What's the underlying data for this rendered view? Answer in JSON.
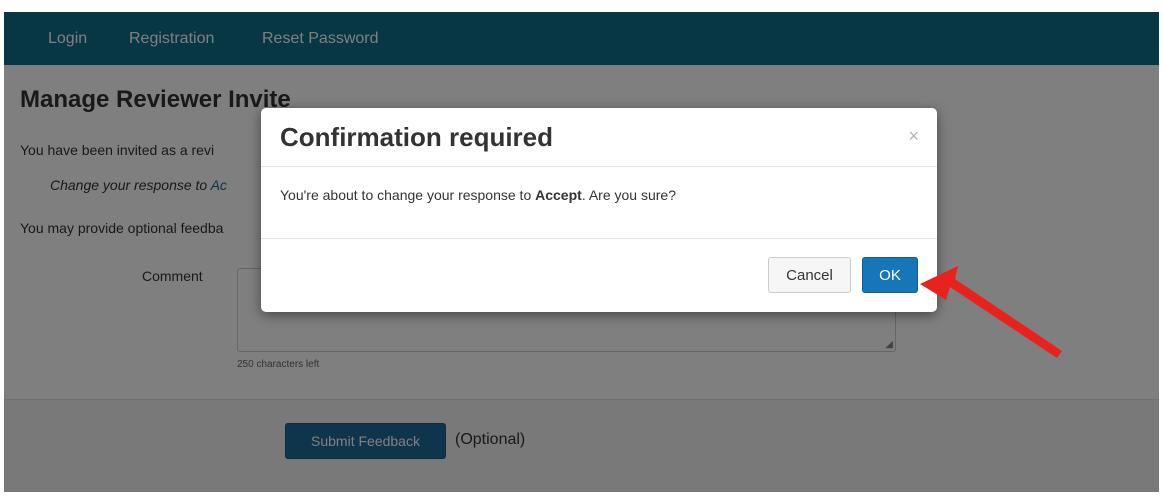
{
  "navbar": {
    "items": [
      {
        "label": "Login"
      },
      {
        "label": "Registration"
      },
      {
        "label": "Reset Password"
      }
    ]
  },
  "page": {
    "title": "Manage Reviewer Invite",
    "intro": "You have been invited as a revi",
    "change_response_prefix": "Change your response to ",
    "change_response_link": "Ac",
    "feedback_hint": "You may provide optional feedba",
    "comment_label": "Comment",
    "chars_left": "250 characters left",
    "submit_label": "Submit Feedback",
    "optional_label": "(Optional)"
  },
  "modal": {
    "title": "Confirmation required",
    "close_glyph": "×",
    "body_prefix": "You're about to change your response to ",
    "body_emphasis": "Accept",
    "body_suffix": ". Are you sure?",
    "cancel_label": "Cancel",
    "ok_label": "OK"
  },
  "colors": {
    "navbar": "#0e6d88",
    "primary_button": "#1676b8",
    "annotation_arrow": "#e8231e"
  },
  "icons": {
    "close": "close-icon",
    "annotation": "red-arrow-icon",
    "resize": "resize-grip-icon"
  }
}
